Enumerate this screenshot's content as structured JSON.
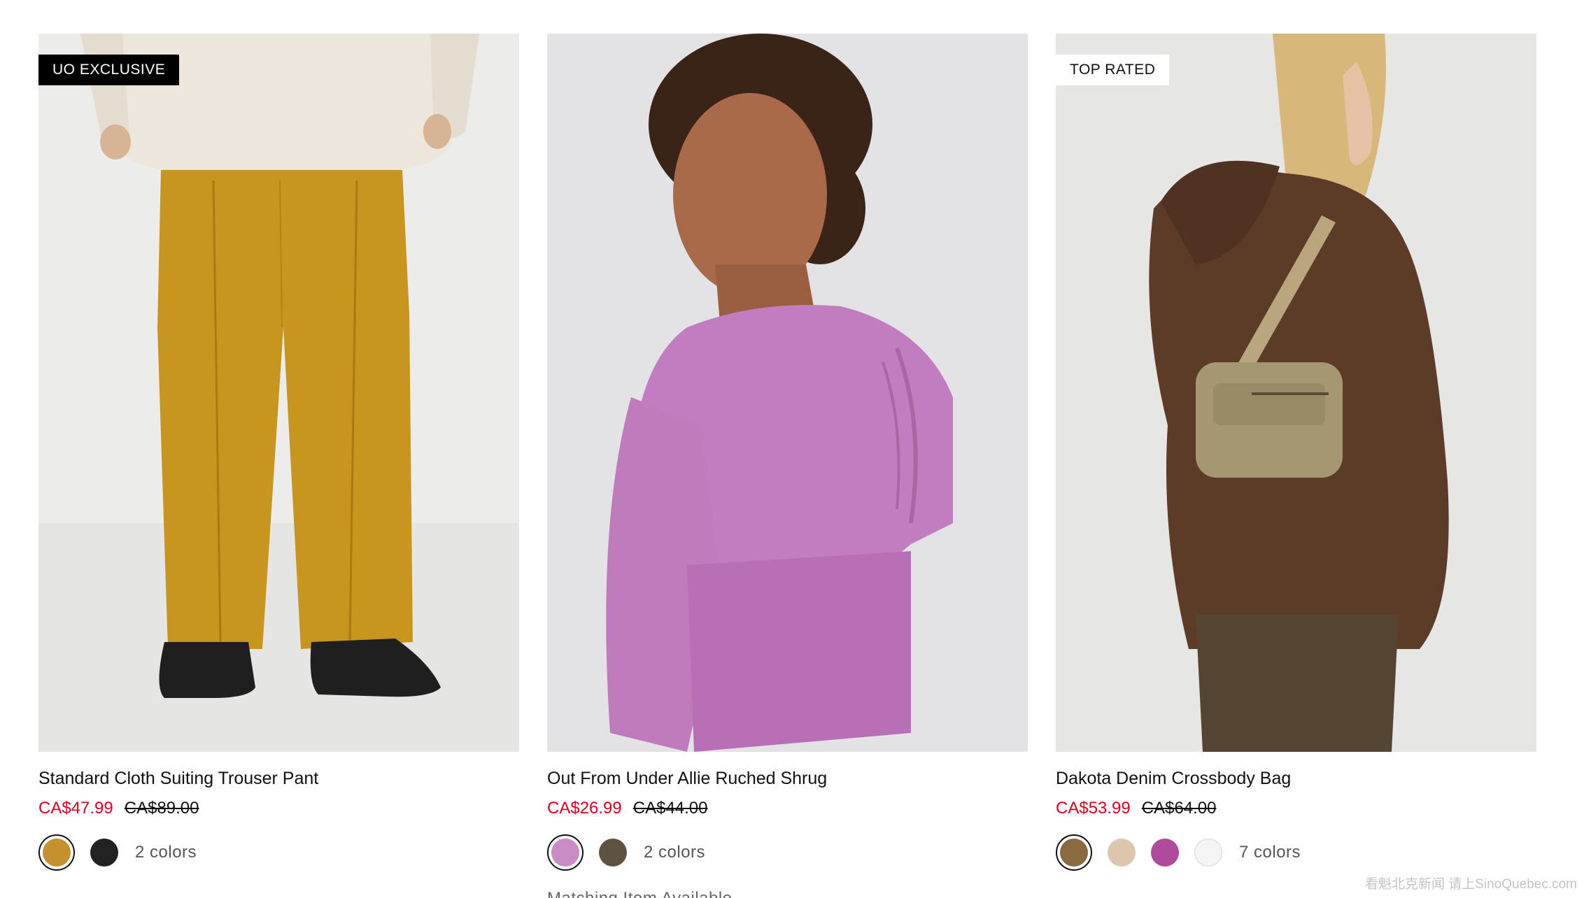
{
  "products": [
    {
      "badge": "UO EXCLUSIVE",
      "title": "Standard Cloth Suiting Trouser Pant",
      "sale_price": "CA$47.99",
      "original_price": "CA$89.00",
      "colors_label": "2 colors",
      "swatches": [
        "#c7902e",
        "#222222"
      ],
      "image": "trouser-pant-photo"
    },
    {
      "badge": "",
      "title": "Out From Under Allie Ruched Shrug",
      "sale_price": "CA$26.99",
      "original_price": "CA$44.00",
      "colors_label": "2 colors",
      "swatches": [
        "#c98cc4",
        "#5e5243"
      ],
      "matching": "Matching Item Available",
      "image": "ruched-shrug-photo"
    },
    {
      "badge": "TOP RATED",
      "title": "Dakota Denim Crossbody Bag",
      "sale_price": "CA$53.99",
      "original_price": "CA$64.00",
      "colors_label": "7 colors",
      "swatches": [
        "#8a6a3f",
        "#dcc6ad",
        "#b04a9a",
        "#f5f5f5"
      ],
      "image": "crossbody-bag-photo"
    }
  ],
  "colors": {
    "sale": "#e5001e",
    "badge_dark": "#000000"
  },
  "watermark": "看魁北克新闻 请上SinoQuebec.com"
}
